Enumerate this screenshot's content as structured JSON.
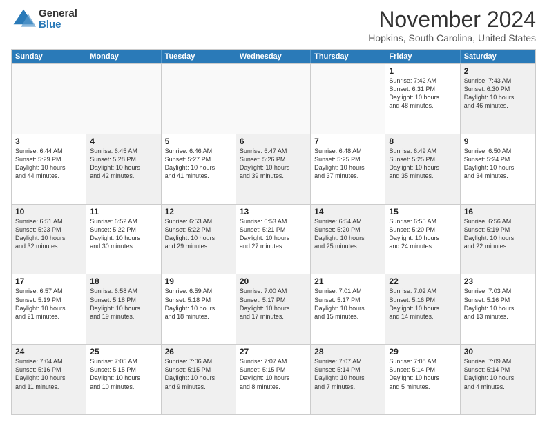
{
  "logo": {
    "general": "General",
    "blue": "Blue"
  },
  "header": {
    "month": "November 2024",
    "location": "Hopkins, South Carolina, United States"
  },
  "weekdays": [
    "Sunday",
    "Monday",
    "Tuesday",
    "Wednesday",
    "Thursday",
    "Friday",
    "Saturday"
  ],
  "rows": [
    [
      {
        "day": "",
        "info": "",
        "empty": true
      },
      {
        "day": "",
        "info": "",
        "empty": true
      },
      {
        "day": "",
        "info": "",
        "empty": true
      },
      {
        "day": "",
        "info": "",
        "empty": true
      },
      {
        "day": "",
        "info": "",
        "empty": true
      },
      {
        "day": "1",
        "info": "Sunrise: 7:42 AM\nSunset: 6:31 PM\nDaylight: 10 hours\nand 48 minutes."
      },
      {
        "day": "2",
        "info": "Sunrise: 7:43 AM\nSunset: 6:30 PM\nDaylight: 10 hours\nand 46 minutes.",
        "shaded": true
      }
    ],
    [
      {
        "day": "3",
        "info": "Sunrise: 6:44 AM\nSunset: 5:29 PM\nDaylight: 10 hours\nand 44 minutes."
      },
      {
        "day": "4",
        "info": "Sunrise: 6:45 AM\nSunset: 5:28 PM\nDaylight: 10 hours\nand 42 minutes.",
        "shaded": true
      },
      {
        "day": "5",
        "info": "Sunrise: 6:46 AM\nSunset: 5:27 PM\nDaylight: 10 hours\nand 41 minutes."
      },
      {
        "day": "6",
        "info": "Sunrise: 6:47 AM\nSunset: 5:26 PM\nDaylight: 10 hours\nand 39 minutes.",
        "shaded": true
      },
      {
        "day": "7",
        "info": "Sunrise: 6:48 AM\nSunset: 5:25 PM\nDaylight: 10 hours\nand 37 minutes."
      },
      {
        "day": "8",
        "info": "Sunrise: 6:49 AM\nSunset: 5:25 PM\nDaylight: 10 hours\nand 35 minutes.",
        "shaded": true
      },
      {
        "day": "9",
        "info": "Sunrise: 6:50 AM\nSunset: 5:24 PM\nDaylight: 10 hours\nand 34 minutes."
      }
    ],
    [
      {
        "day": "10",
        "info": "Sunrise: 6:51 AM\nSunset: 5:23 PM\nDaylight: 10 hours\nand 32 minutes.",
        "shaded": true
      },
      {
        "day": "11",
        "info": "Sunrise: 6:52 AM\nSunset: 5:22 PM\nDaylight: 10 hours\nand 30 minutes."
      },
      {
        "day": "12",
        "info": "Sunrise: 6:53 AM\nSunset: 5:22 PM\nDaylight: 10 hours\nand 29 minutes.",
        "shaded": true
      },
      {
        "day": "13",
        "info": "Sunrise: 6:53 AM\nSunset: 5:21 PM\nDaylight: 10 hours\nand 27 minutes."
      },
      {
        "day": "14",
        "info": "Sunrise: 6:54 AM\nSunset: 5:20 PM\nDaylight: 10 hours\nand 25 minutes.",
        "shaded": true
      },
      {
        "day": "15",
        "info": "Sunrise: 6:55 AM\nSunset: 5:20 PM\nDaylight: 10 hours\nand 24 minutes."
      },
      {
        "day": "16",
        "info": "Sunrise: 6:56 AM\nSunset: 5:19 PM\nDaylight: 10 hours\nand 22 minutes.",
        "shaded": true
      }
    ],
    [
      {
        "day": "17",
        "info": "Sunrise: 6:57 AM\nSunset: 5:19 PM\nDaylight: 10 hours\nand 21 minutes."
      },
      {
        "day": "18",
        "info": "Sunrise: 6:58 AM\nSunset: 5:18 PM\nDaylight: 10 hours\nand 19 minutes.",
        "shaded": true
      },
      {
        "day": "19",
        "info": "Sunrise: 6:59 AM\nSunset: 5:18 PM\nDaylight: 10 hours\nand 18 minutes."
      },
      {
        "day": "20",
        "info": "Sunrise: 7:00 AM\nSunset: 5:17 PM\nDaylight: 10 hours\nand 17 minutes.",
        "shaded": true
      },
      {
        "day": "21",
        "info": "Sunrise: 7:01 AM\nSunset: 5:17 PM\nDaylight: 10 hours\nand 15 minutes."
      },
      {
        "day": "22",
        "info": "Sunrise: 7:02 AM\nSunset: 5:16 PM\nDaylight: 10 hours\nand 14 minutes.",
        "shaded": true
      },
      {
        "day": "23",
        "info": "Sunrise: 7:03 AM\nSunset: 5:16 PM\nDaylight: 10 hours\nand 13 minutes."
      }
    ],
    [
      {
        "day": "24",
        "info": "Sunrise: 7:04 AM\nSunset: 5:16 PM\nDaylight: 10 hours\nand 11 minutes.",
        "shaded": true
      },
      {
        "day": "25",
        "info": "Sunrise: 7:05 AM\nSunset: 5:15 PM\nDaylight: 10 hours\nand 10 minutes."
      },
      {
        "day": "26",
        "info": "Sunrise: 7:06 AM\nSunset: 5:15 PM\nDaylight: 10 hours\nand 9 minutes.",
        "shaded": true
      },
      {
        "day": "27",
        "info": "Sunrise: 7:07 AM\nSunset: 5:15 PM\nDaylight: 10 hours\nand 8 minutes."
      },
      {
        "day": "28",
        "info": "Sunrise: 7:07 AM\nSunset: 5:14 PM\nDaylight: 10 hours\nand 7 minutes.",
        "shaded": true
      },
      {
        "day": "29",
        "info": "Sunrise: 7:08 AM\nSunset: 5:14 PM\nDaylight: 10 hours\nand 5 minutes."
      },
      {
        "day": "30",
        "info": "Sunrise: 7:09 AM\nSunset: 5:14 PM\nDaylight: 10 hours\nand 4 minutes.",
        "shaded": true
      }
    ]
  ]
}
